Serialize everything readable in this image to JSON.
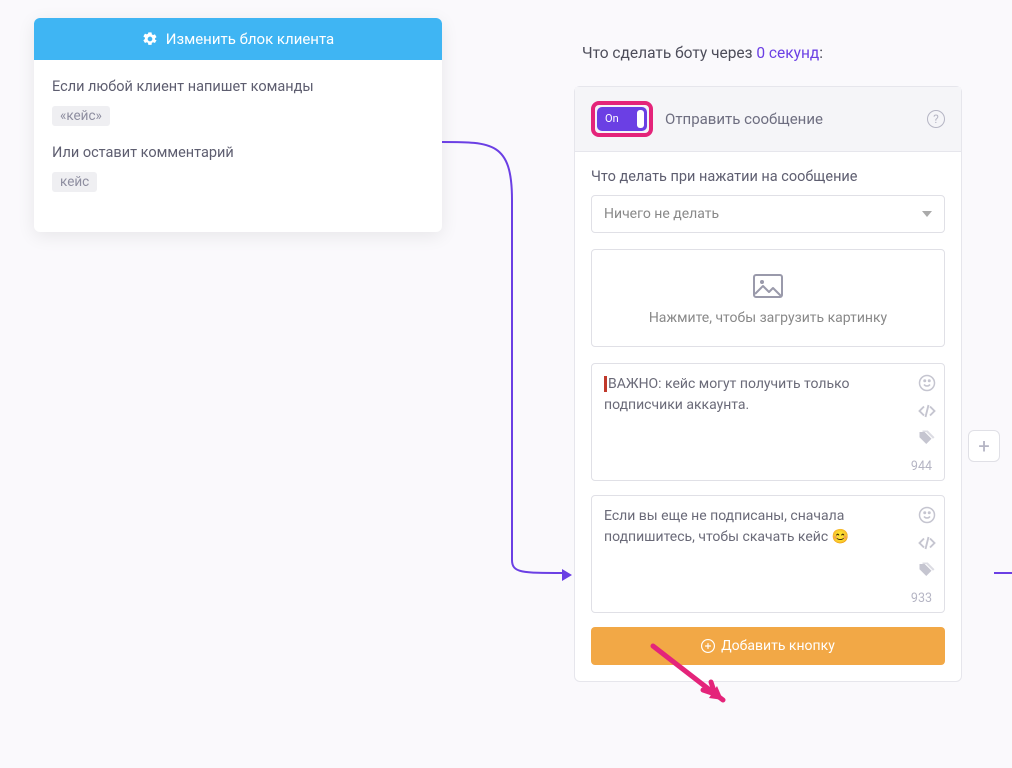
{
  "left": {
    "header": "Изменить блок клиента",
    "line1": "Если любой клиент напишет команды",
    "tag1": "«кейс»",
    "line2": "Или оставит комментарий",
    "tag2": "кейс"
  },
  "right": {
    "top_prefix": "Что сделать боту через ",
    "delay": "0 секунд",
    "top_suffix": ":",
    "toggle_state": "On",
    "panel_title": "Отправить сообщение",
    "click_label": "Что делать при нажатии на сообщение",
    "dropdown_value": "Ничего не делать",
    "upload_hint": "Нажмите, чтобы загрузить картинку",
    "msg1": "ВАЖНО: кейс могут получить только подписчики аккаунта.",
    "msg1_count": "944",
    "msg2": "Если вы еще не подписаны, сначала подпишитесь, чтобы скачать кейс 😊",
    "msg2_count": "933",
    "add_button": "Добавить кнопку"
  }
}
